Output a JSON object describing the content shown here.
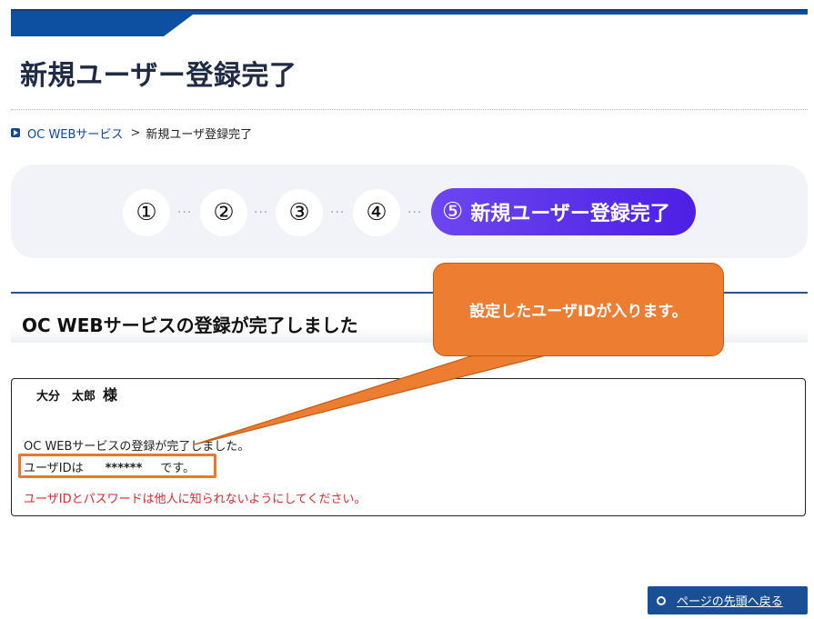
{
  "page": {
    "title": "新規ユーザー登録完了"
  },
  "breadcrumb": {
    "home_label": "OC WEBサービス",
    "separator": ">",
    "current": "新規ユーザ登録完了"
  },
  "steps": {
    "items": [
      "①",
      "②",
      "③",
      "④"
    ],
    "dots": "···",
    "active_number": "⑤",
    "active_label": "新規ユーザー登録完了"
  },
  "section": {
    "title": "OC WEBサービスの登録が完了しました"
  },
  "message": {
    "name": "大分　太郎",
    "honorific": "様",
    "line1": "OC WEBサービスの登録が完了しました。",
    "userid_prefix": "ユーザIDは",
    "userid_value": "******",
    "userid_suffix": "です。",
    "warning": "ユーザIDとパスワードは他人に知られないようにしてください。"
  },
  "callout": {
    "text": "設定したユーザIDが入ります。"
  },
  "footer": {
    "back_to_top_label": "ページの先頭へ戻る"
  },
  "colors": {
    "header_band": "#0d4fa0",
    "step_active": "#5a2ff0",
    "callout": "#ed7d31",
    "warning_text": "#e0262a",
    "back_button": "#1a4f95"
  }
}
